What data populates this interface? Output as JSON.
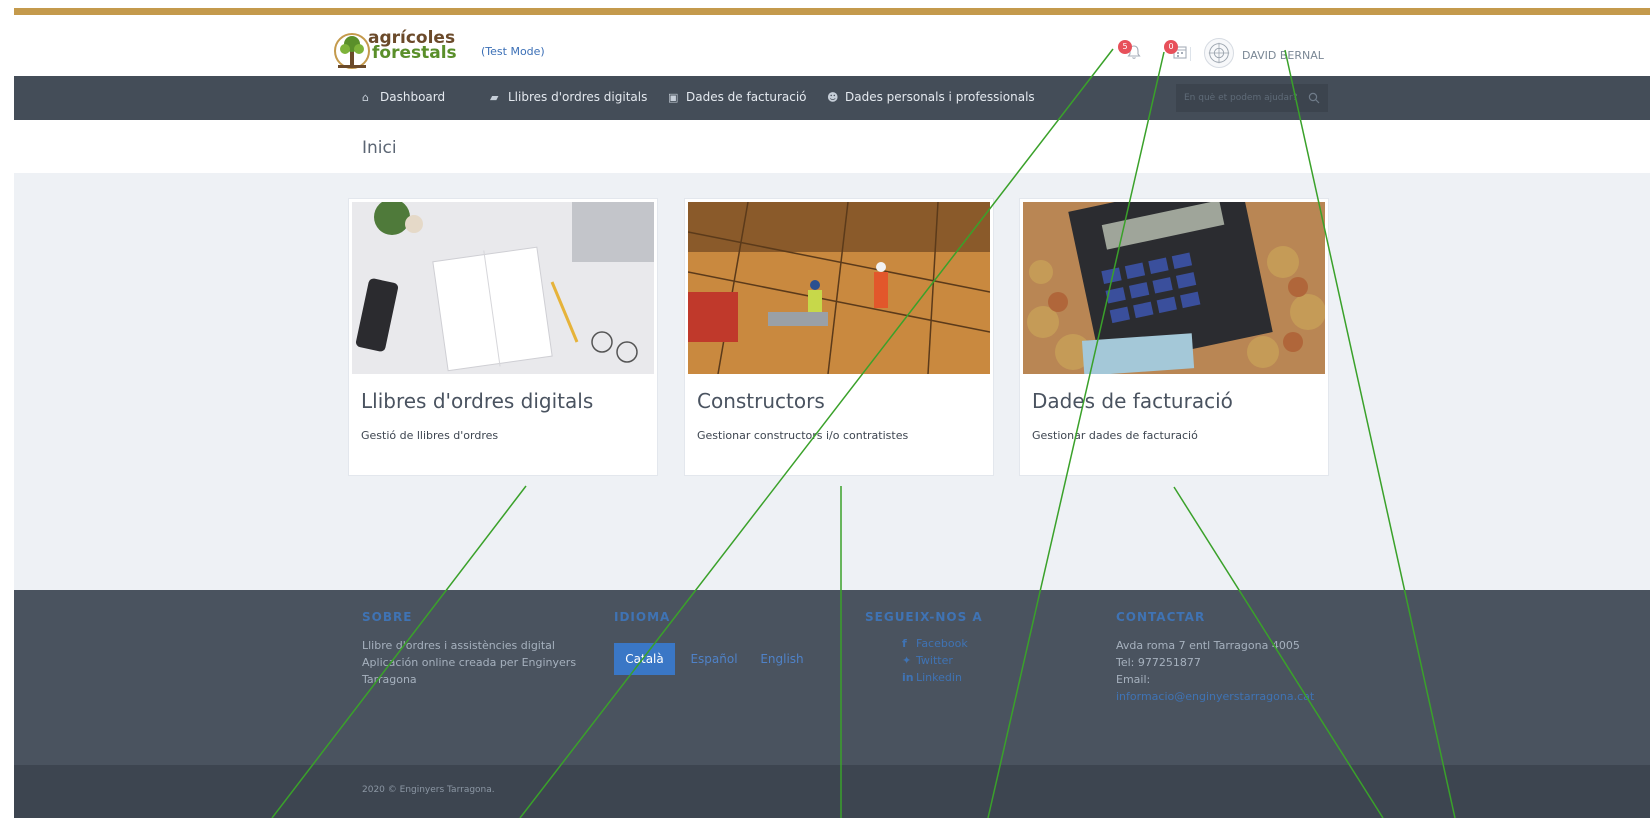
{
  "header": {
    "logo_line1": "agrícoles",
    "logo_line2": "forestals",
    "test_mode": "(Test Mode)",
    "notifications_count": "5",
    "calendar_count": "0",
    "user_name": "DAVID BERNAL"
  },
  "nav": {
    "items": [
      {
        "label": "Dashboard",
        "icon": "home-icon"
      },
      {
        "label": "Llibres d'ordres digitals",
        "icon": "book-icon"
      },
      {
        "label": "Dades de facturació",
        "icon": "money-icon"
      },
      {
        "label": "Dades personals i professionals",
        "icon": "users-icon"
      }
    ],
    "search_placeholder": "En què et podem ajudar?"
  },
  "page": {
    "title": "Inici"
  },
  "cards": [
    {
      "title": "Llibres d'ordres digitals",
      "desc": "Gestió de llibres d'ordres",
      "image": "notebook-desk-photo"
    },
    {
      "title": "Constructors",
      "desc": "Gestionar constructors i/o contratistes",
      "image": "construction-site-photo"
    },
    {
      "title": "Dades de facturació",
      "desc": "Gestionar dades de facturació",
      "image": "calculator-coins-photo"
    }
  ],
  "footer": {
    "about": {
      "heading": "SOBRE",
      "line1": "Llibre d'ordres i assistències digital",
      "line2": "Aplicación online creada per Enginyers",
      "line3": "Tarragona"
    },
    "language": {
      "heading": "IDIOMA",
      "options": [
        "Català",
        "Español",
        "English"
      ],
      "selected": "Català"
    },
    "follow": {
      "heading": "SEGUEIX-NOS A",
      "links": [
        "Facebook",
        "Twitter",
        "Linkedin"
      ]
    },
    "contact": {
      "heading": "CONTACTAR",
      "address": "Avda roma 7 entl Tarragona 4005",
      "tel": "Tel: 977251877",
      "email_label": "Email:",
      "email": "informacio@enginyerstarragona.cat"
    },
    "copyright": "2020 © Enginyers Tarragona."
  },
  "colors": {
    "top_accent": "#c49a4c",
    "navbar": "#444d58",
    "footer": "#4a535f",
    "link_blue": "#3f73b4",
    "badge_red": "#e7505a",
    "annotation_green": "#3aa12a"
  }
}
